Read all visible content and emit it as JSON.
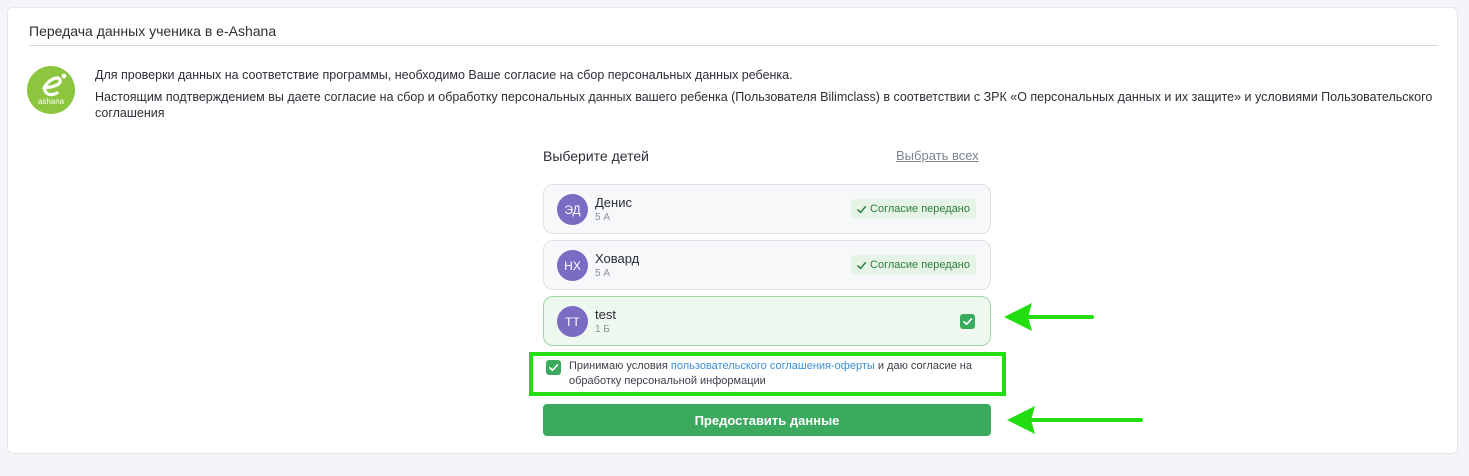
{
  "panel": {
    "title": "Передача данных ученика в e-Ashana",
    "logo_text": "ashana",
    "info_line1": "Для проверки данных на соответствие программы, необходимо Ваше согласие на сбор персональных данных ребенка.",
    "info_line2": "Настоящим подтверждением вы даете согласие на сбор и обработку персональных данных вашего ребенка (Пользователя Bilimclass) в соответствии с ЗРК «О персональных данных и их защите» и условиями Пользовательского соглашения"
  },
  "selection": {
    "title": "Выберите детей",
    "select_all": "Выбрать всех"
  },
  "children": [
    {
      "initials": "ЭД",
      "name": "Денис",
      "class": "5 А",
      "status": "Согласие передано"
    },
    {
      "initials": "НХ",
      "name": "Ховард",
      "class": "5 А",
      "status": "Согласие передано"
    },
    {
      "initials": "TT",
      "name": "test",
      "class": "1 Б",
      "selected": true
    }
  ],
  "agreement": {
    "text_before": "Принимаю условия ",
    "link": "пользовательского соглашения-оферты",
    "text_after": " и даю согласие на обработку персональной информации",
    "checked": true
  },
  "submit_label": "Предоставить данные",
  "colors": {
    "accent_green": "#3caa5e",
    "highlight": "#22dd11",
    "avatar": "#7b6bc2",
    "logo": "#8cc63f",
    "link": "#3b8fd6"
  },
  "icons": {
    "logo": "e-ashana-logo",
    "status": "checkmark-icon",
    "checkbox": "checkbox-checked-icon",
    "annotation": "arrow-left-icon"
  }
}
